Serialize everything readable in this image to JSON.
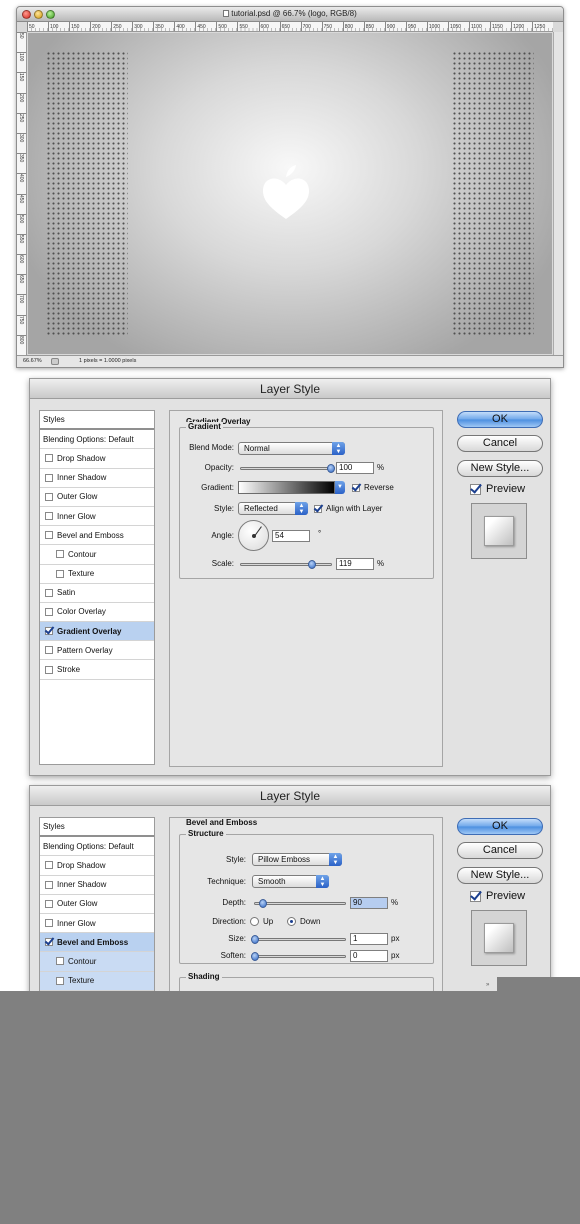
{
  "ps_window": {
    "title": "tutorial.psd @ 66.7% (logo, RGB/8)",
    "ruler_ticks": [
      "50",
      "100",
      "150",
      "200",
      "250",
      "300",
      "350",
      "400",
      "450",
      "500",
      "550",
      "600",
      "650",
      "700",
      "750",
      "800",
      "850",
      "900",
      "950",
      "1000",
      "1050",
      "1100",
      "1150",
      "1200",
      "1250"
    ],
    "ruler_left_ticks": [
      "50",
      "100",
      "150",
      "200",
      "250",
      "300",
      "350",
      "400",
      "450",
      "500",
      "550",
      "600",
      "650",
      "700",
      "750",
      "800"
    ],
    "status_zoom": "66.67%",
    "status_info": "1 pixels = 1.0000 pixels"
  },
  "dialog1": {
    "title": "Layer Style",
    "styles_header": "Styles",
    "blending_options": "Blending Options: Default",
    "items": [
      {
        "label": "Drop Shadow",
        "checked": false
      },
      {
        "label": "Inner Shadow",
        "checked": false
      },
      {
        "label": "Outer Glow",
        "checked": false
      },
      {
        "label": "Inner Glow",
        "checked": false
      },
      {
        "label": "Bevel and Emboss",
        "checked": false
      },
      {
        "label": "Contour",
        "checked": false
      },
      {
        "label": "Texture",
        "checked": false
      },
      {
        "label": "Satin",
        "checked": false
      },
      {
        "label": "Color Overlay",
        "checked": false
      },
      {
        "label": "Gradient Overlay",
        "checked": true
      },
      {
        "label": "Pattern Overlay",
        "checked": false
      },
      {
        "label": "Stroke",
        "checked": false
      }
    ],
    "section_title": "Gradient Overlay",
    "group_title": "Gradient",
    "blend_mode_label": "Blend Mode:",
    "blend_mode_value": "Normal",
    "opacity_label": "Opacity:",
    "opacity_value": "100",
    "opacity_percent": 100,
    "gradient_label": "Gradient:",
    "reverse_label": "Reverse",
    "reverse_checked": true,
    "style_label": "Style:",
    "style_value": "Reflected",
    "align_label": "Align with Layer",
    "align_checked": true,
    "angle_label": "Angle:",
    "angle_value": "54",
    "angle_unit": "°",
    "scale_label": "Scale:",
    "scale_value": "119",
    "scale_percent": 119,
    "percent_unit": "%"
  },
  "dialog2": {
    "title": "Layer Style",
    "styles_header": "Styles",
    "blending_options": "Blending Options: Default",
    "items": [
      {
        "label": "Drop Shadow",
        "checked": false
      },
      {
        "label": "Inner Shadow",
        "checked": false
      },
      {
        "label": "Outer Glow",
        "checked": false
      },
      {
        "label": "Inner Glow",
        "checked": false
      },
      {
        "label": "Bevel and Emboss",
        "checked": true
      },
      {
        "label": "Contour",
        "checked": false
      },
      {
        "label": "Texture",
        "checked": false
      }
    ],
    "section_title": "Bevel and Emboss",
    "group_title": "Structure",
    "style_label": "Style:",
    "style_value": "Pillow Emboss",
    "technique_label": "Technique:",
    "technique_value": "Smooth",
    "depth_label": "Depth:",
    "depth_value": "90",
    "depth_percent": 90,
    "direction_label": "Direction:",
    "direction_up": "Up",
    "direction_down": "Down",
    "direction_selected": "Down",
    "size_label": "Size:",
    "size_value": "1",
    "soften_label": "Soften:",
    "soften_value": "0",
    "px_unit": "px",
    "percent_unit": "%",
    "shading_title": "Shading"
  },
  "buttons": {
    "ok": "OK",
    "cancel": "Cancel",
    "new_style": "New Style...",
    "preview": "Preview",
    "preview_checked": true
  },
  "colors": {
    "selection": "#b9d1f0",
    "accent_blue": "#4b8ee0",
    "bottom_gray": "#808080"
  }
}
